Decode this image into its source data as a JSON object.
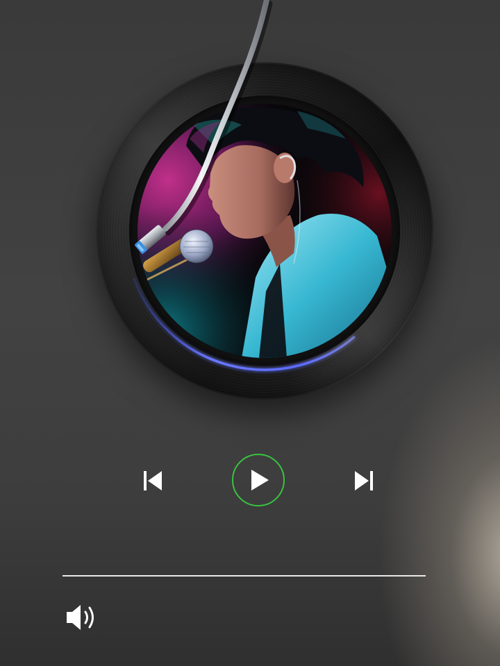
{
  "player": {
    "playback_progress": 0.55,
    "is_playing": false,
    "colors": {
      "accent_ring": "#37c43f",
      "progress_glow": "#5b6bff",
      "icon": "#ffffff",
      "timeline": "#e9e9e9"
    }
  },
  "controls": {
    "prev_icon": "skip-previous-icon",
    "play_icon": "play-icon",
    "next_icon": "skip-next-icon",
    "volume_icon": "volume-icon"
  }
}
